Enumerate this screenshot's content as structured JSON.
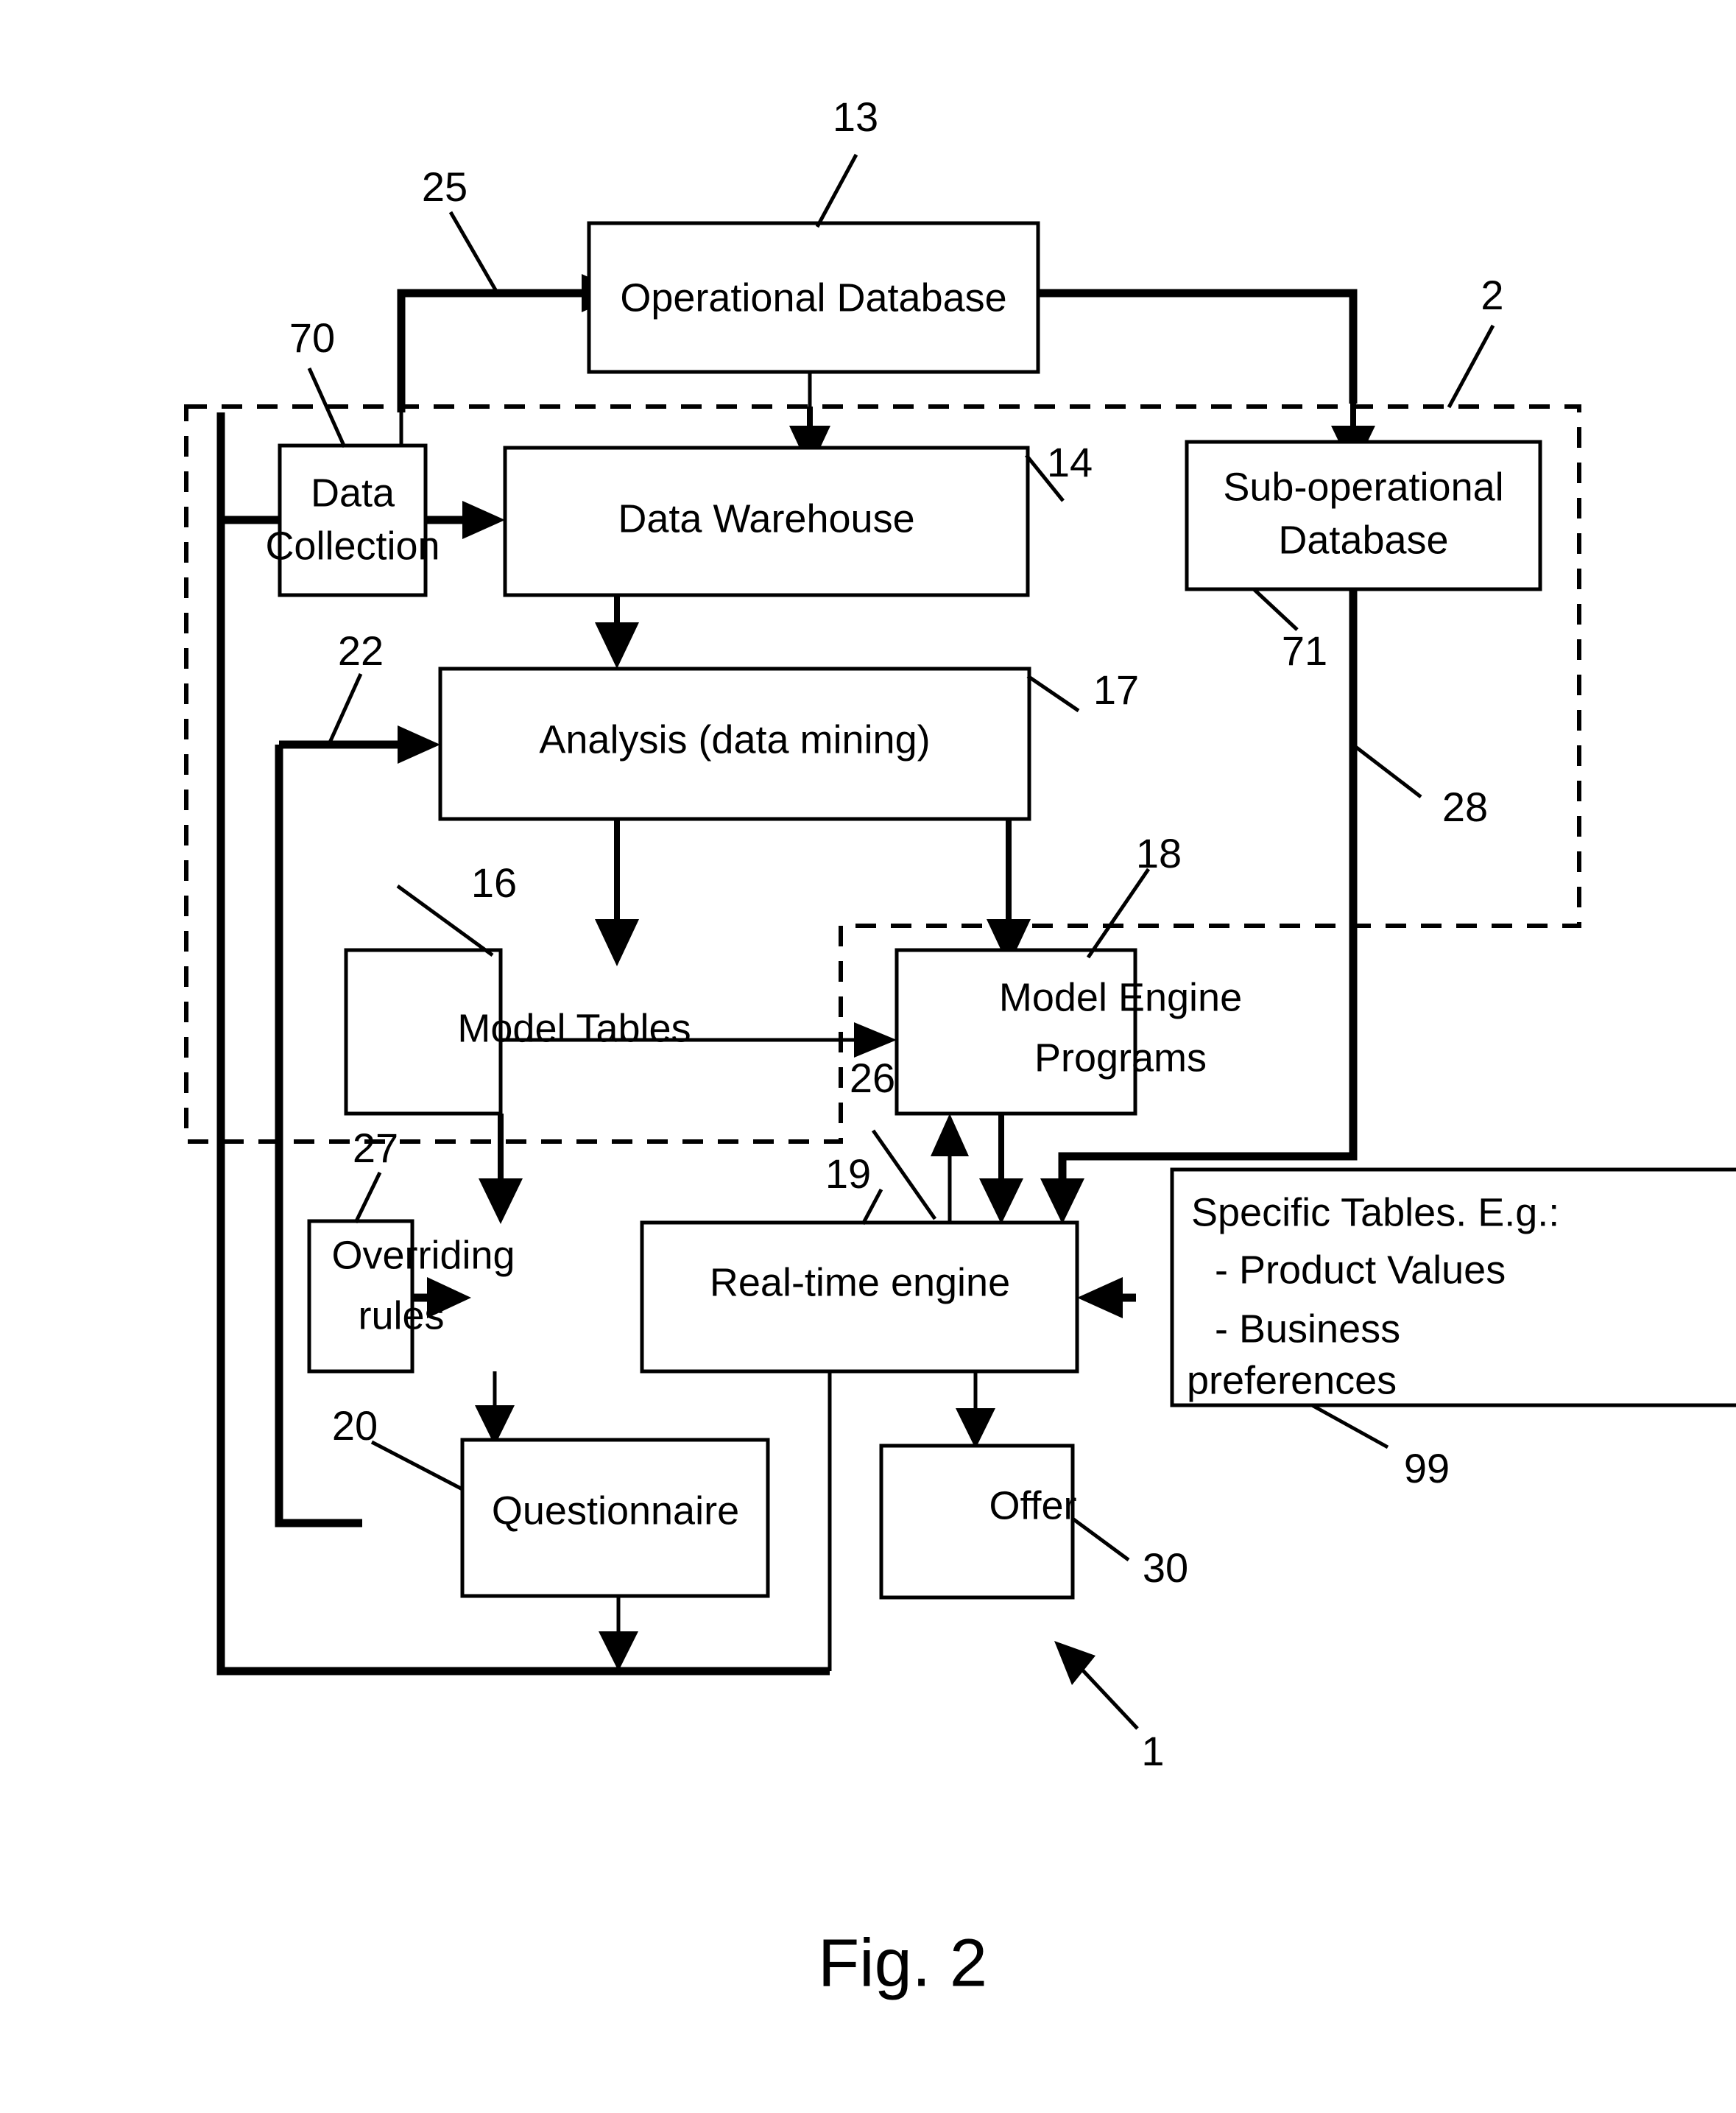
{
  "figure": {
    "caption": "Fig. 2",
    "title": "Fig. 2"
  },
  "nodes": {
    "operational_database": {
      "label": "Operational Database",
      "ref": "13"
    },
    "data_collection": {
      "label_line1": "Data",
      "label_line2": "Collection",
      "ref": "70"
    },
    "data_warehouse": {
      "label": "Data Warehouse",
      "ref": "14"
    },
    "sub_operational_database": {
      "label_line1": "Sub-operational",
      "label_line2": "Database",
      "ref": "71"
    },
    "analysis": {
      "label": "Analysis (data mining)",
      "ref": "17"
    },
    "model_tables": {
      "label": "Model Tables",
      "ref": "16"
    },
    "model_engine_programs": {
      "label_line1": "Model Engine",
      "label_line2": "Programs",
      "ref": "18"
    },
    "overriding_rules": {
      "label_line1": "Overriding",
      "label_line2": "rules",
      "ref": "27"
    },
    "realtime_engine": {
      "label": "Real-time engine",
      "ref": "19"
    },
    "specific_tables": {
      "label_line1": "Specific Tables. E.g.:",
      "label_line2": "- Product Values",
      "label_line3": "- Business",
      "label_line4": "preferences",
      "ref": "99"
    },
    "questionnaire": {
      "label": "Questionnaire",
      "ref": "20"
    },
    "offer": {
      "label": "Offer",
      "ref": "30"
    }
  },
  "reference_numerals": {
    "system": "1",
    "boundary_outer": "2",
    "operational_database": "13",
    "data_warehouse": "14",
    "model_tables": "16",
    "analysis": "17",
    "model_engine_programs": "18",
    "realtime_engine": "19",
    "questionnaire": "20",
    "analysis_feedback": "22",
    "operational_feedback": "25",
    "model_engine_feedback": "26",
    "overriding_rules": "27",
    "sub_operational_link": "28",
    "offer": "30",
    "data_collection": "70",
    "sub_operational_database": "71",
    "specific_tables": "99"
  },
  "colors": {
    "ink": "#000000",
    "paper": "#ffffff"
  }
}
